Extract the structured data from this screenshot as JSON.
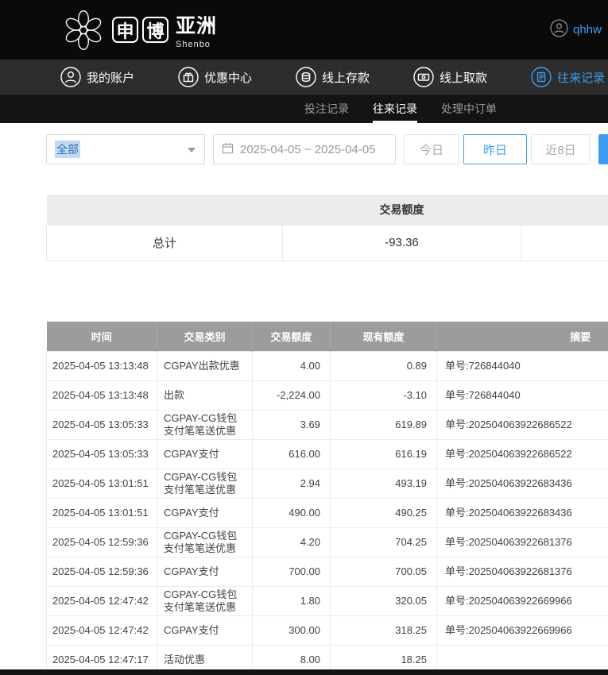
{
  "header": {
    "logo": {
      "char1": "申",
      "char2": "博",
      "suffix": "亚洲",
      "subtitle": "Shenbo"
    },
    "username": "qhhw"
  },
  "nav": {
    "items": [
      {
        "label": "我的账户",
        "icon": "user-icon",
        "active": false
      },
      {
        "label": "优惠中心",
        "icon": "gift-icon",
        "active": false
      },
      {
        "label": "线上存款",
        "icon": "deposit-coins-icon",
        "active": false
      },
      {
        "label": "线上取款",
        "icon": "withdraw-banknote-icon",
        "active": false
      },
      {
        "label": "往来记录",
        "icon": "records-document-icon",
        "active": true
      }
    ]
  },
  "subnav": {
    "tabs": [
      {
        "label": "投注记录",
        "active": false
      },
      {
        "label": "往来记录",
        "active": true
      },
      {
        "label": "处理中订单",
        "active": false
      }
    ]
  },
  "filters": {
    "type_select_value": "全部",
    "date_range_value": "2025-04-05 ~ 2025-04-05",
    "quick_buttons": [
      {
        "label": "今日",
        "active": false
      },
      {
        "label": "昨日",
        "active": true
      },
      {
        "label": "近8日",
        "active": false
      }
    ]
  },
  "summary": {
    "header": "交易额度",
    "total_label": "总计",
    "total_value": "-93.36"
  },
  "table": {
    "columns": [
      "时间",
      "交易类别",
      "交易额度",
      "现有额度",
      "摘要"
    ],
    "rows": [
      [
        "2025-04-05 13:13:48",
        "CGPAY出款优惠",
        "4.00",
        "0.89",
        "单号:726844040"
      ],
      [
        "2025-04-05 13:13:48",
        "出款",
        "-2,224.00",
        "-3.10",
        "单号:726844040"
      ],
      [
        "2025-04-05 13:05:33",
        "CGPAY-CG钱包支付笔笔送优惠",
        "3.69",
        "619.89",
        "单号:202504063922686522"
      ],
      [
        "2025-04-05 13:05:33",
        "CGPAY支付",
        "616.00",
        "616.19",
        "单号:202504063922686522"
      ],
      [
        "2025-04-05 13:01:51",
        "CGPAY-CG钱包支付笔笔送优惠",
        "2.94",
        "493.19",
        "单号:202504063922683436"
      ],
      [
        "2025-04-05 13:01:51",
        "CGPAY支付",
        "490.00",
        "490.25",
        "单号:202504063922683436"
      ],
      [
        "2025-04-05 12:59:36",
        "CGPAY-CG钱包支付笔笔送优惠",
        "4.20",
        "704.25",
        "单号:202504063922681376"
      ],
      [
        "2025-04-05 12:59:36",
        "CGPAY支付",
        "700.00",
        "700.05",
        "单号:202504063922681376"
      ],
      [
        "2025-04-05 12:47:42",
        "CGPAY-CG钱包支付笔笔送优惠",
        "1.80",
        "320.05",
        "单号:202504063922669966"
      ],
      [
        "2025-04-05 12:47:42",
        "CGPAY支付",
        "300.00",
        "318.25",
        "单号:202504063922669966"
      ],
      [
        "2025-04-05 12:47:17",
        "活动优惠",
        "8.00",
        "18.25",
        ""
      ]
    ]
  },
  "colors": {
    "accent": "#3d9df3",
    "table_header_bg": "#9c9c9c",
    "topbar_bg": "#0a0a0a"
  }
}
